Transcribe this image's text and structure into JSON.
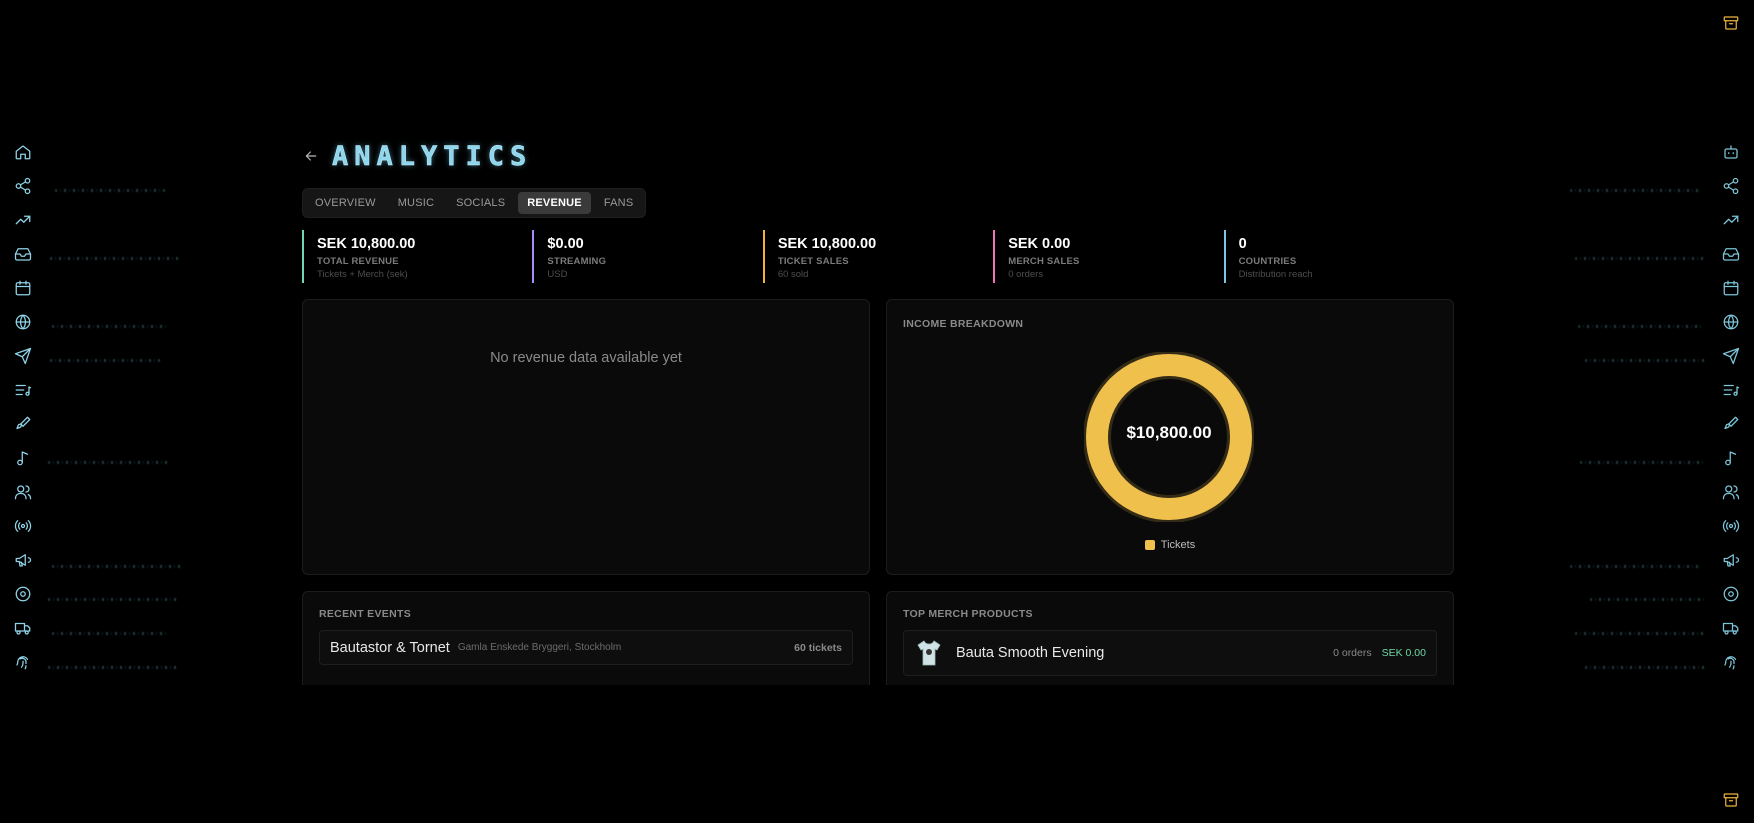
{
  "page": {
    "title": "ANALYTICS"
  },
  "tabs": [
    {
      "label": "OVERVIEW",
      "active": false
    },
    {
      "label": "MUSIC",
      "active": false
    },
    {
      "label": "SOCIALS",
      "active": false
    },
    {
      "label": "REVENUE",
      "active": true
    },
    {
      "label": "FANS",
      "active": false
    }
  ],
  "stats": [
    {
      "value": "SEK 10,800.00",
      "label": "TOTAL REVENUE",
      "sub": "Tickets + Merch (sek)",
      "color": "#6fd6b8"
    },
    {
      "value": "$0.00",
      "label": "STREAMING",
      "sub": "USD",
      "color": "#a78bfa"
    },
    {
      "value": "SEK 10,800.00",
      "label": "TICKET SALES",
      "sub": "60 sold",
      "color": "#f0b43c"
    },
    {
      "value": "SEK 0.00",
      "label": "MERCH SALES",
      "sub": "0 orders",
      "color": "#f472b6"
    },
    {
      "value": "0",
      "label": "COUNTRIES",
      "sub": "Distribution reach",
      "color": "#7cc4e8"
    }
  ],
  "revenue_chart": {
    "empty_message": "No revenue data available yet"
  },
  "income_breakdown": {
    "title": "INCOME BREAKDOWN",
    "total": "$10,800.00",
    "legend": [
      {
        "name": "Tickets",
        "color": "#f0c04c"
      }
    ]
  },
  "chart_data": {
    "type": "pie",
    "title": "INCOME BREAKDOWN",
    "categories": [
      "Tickets"
    ],
    "values": [
      10800
    ],
    "center_label": "$10,800.00"
  },
  "recent_events": {
    "title": "RECENT EVENTS",
    "items": [
      {
        "name": "Bautastor & Tornet",
        "venue": "Gamla Enskede Bryggeri, Stockholm",
        "tickets": "60 tickets"
      }
    ]
  },
  "top_merch": {
    "title": "TOP MERCH PRODUCTS",
    "items": [
      {
        "name": "Bauta Smooth Evening",
        "orders": "0 orders",
        "sales": "SEK 0.00"
      }
    ]
  },
  "rail_left": [
    "home-icon",
    "share-icon",
    "trending-icon",
    "inbox-icon",
    "calendar-icon",
    "globe-icon",
    "send-icon",
    "playlist-icon",
    "brush-icon",
    "music-note-icon",
    "users-icon",
    "broadcast-icon",
    "megaphone-icon",
    "disc-icon",
    "truck-icon",
    "fingerprint-icon"
  ],
  "rail_right": [
    "bot-icon",
    "share-icon",
    "trending-icon",
    "inbox-icon",
    "calendar-icon",
    "globe-icon",
    "send-icon",
    "playlist-icon",
    "brush-icon",
    "music-note-icon",
    "users-icon",
    "broadcast-icon",
    "megaphone-icon",
    "disc-icon",
    "truck-icon",
    "fingerprint-icon"
  ]
}
